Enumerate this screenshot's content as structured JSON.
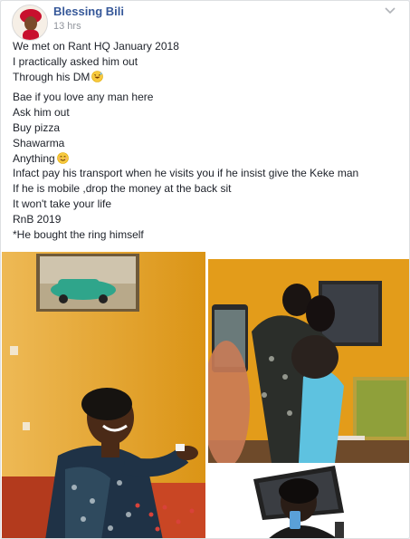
{
  "post": {
    "author": "Blessing Bili",
    "time": "13 hrs",
    "options_icon": "chevron-down-icon"
  },
  "text": {
    "para1": {
      "l1": "We met on Rant HQ January 2018",
      "l2": "I practically asked him out",
      "l3": "Through his DM"
    },
    "para2": {
      "l1": "Bae if you love any man here",
      "l2": "Ask him out",
      "l3": "Buy pizza",
      "l4": "Shawarma",
      "l5": "Anything",
      "l6": "Infact pay his transport when he visits you if he insist give the Keke man",
      "l7": "If he is mobile ,drop the money at the back sit",
      "l8": "It won't take your life",
      "l9": "RnB 2019",
      "l10": "*He bought the ring himself"
    }
  },
  "emojis": {
    "laugh": "grinning-sweat-emoji",
    "blush": "smiling-blush-emoji"
  },
  "photos": [
    {
      "name": "proposal-photo"
    },
    {
      "name": "hug-photo"
    },
    {
      "name": "selfie-photo"
    }
  ],
  "colors": {
    "link": "#365899",
    "text": "#1d2129",
    "meta": "#90949c",
    "wall_orange": "#e8a21d"
  }
}
